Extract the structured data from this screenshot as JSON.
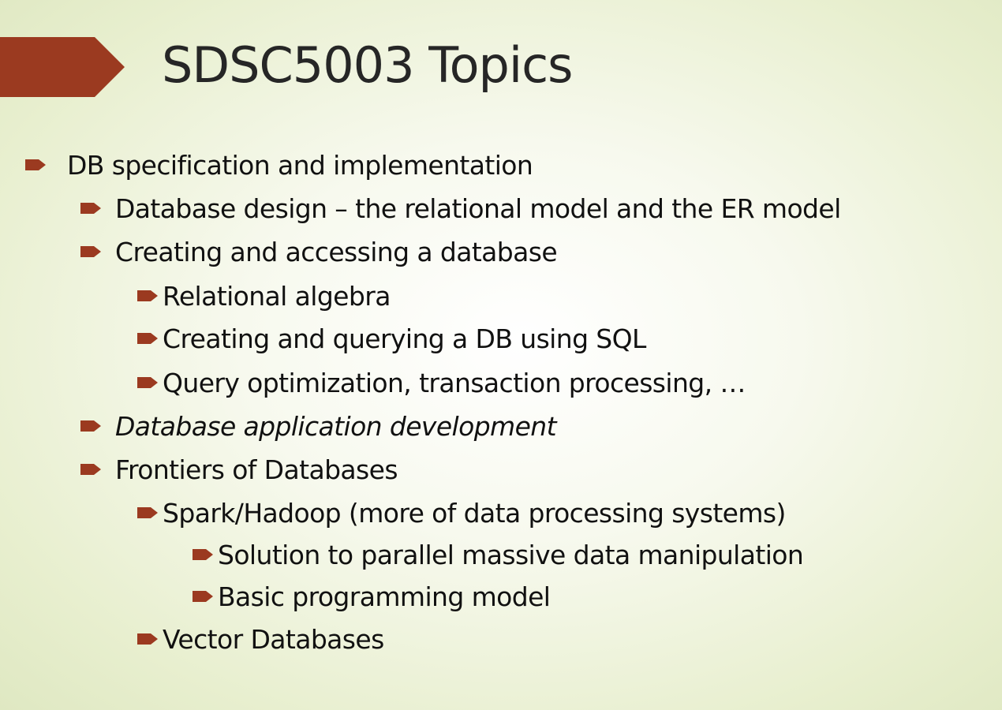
{
  "slide": {
    "title": "SDSC5003 Topics",
    "accent_color": "#9b3a20",
    "bullet_color": "#9b3a20",
    "bullet_icon": "arrow-bullet-icon",
    "items": [
      {
        "level": 0,
        "text": "DB specification and implementation",
        "italic": false
      },
      {
        "level": 1,
        "text": "Database design – the relational model and the ER model",
        "italic": false
      },
      {
        "level": 1,
        "text": "Creating and accessing a database",
        "italic": false
      },
      {
        "level": 2,
        "text": "Relational algebra",
        "italic": false
      },
      {
        "level": 2,
        "text": "Creating and querying a DB using SQL",
        "italic": false
      },
      {
        "level": 2,
        "text": "Query optimization, transaction processing, …",
        "italic": false
      },
      {
        "level": 1,
        "text": "Database application development",
        "italic": true
      },
      {
        "level": 1,
        "text": "Frontiers of Databases",
        "italic": false
      },
      {
        "level": 2,
        "text": "Spark/Hadoop (more of data processing systems)",
        "italic": false
      },
      {
        "level": 3,
        "text": "Solution to parallel massive data manipulation",
        "italic": false
      },
      {
        "level": 3,
        "text": "Basic programming model",
        "italic": false
      },
      {
        "level": 2,
        "text": "Vector Databases",
        "italic": false
      }
    ]
  }
}
